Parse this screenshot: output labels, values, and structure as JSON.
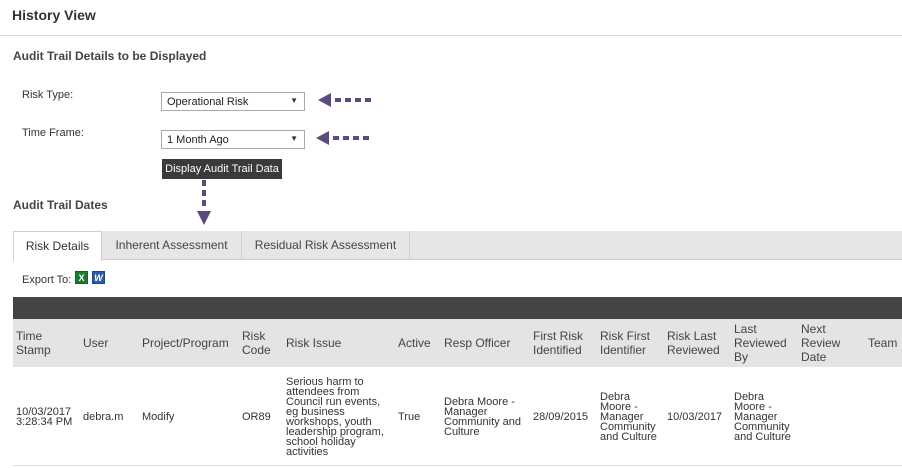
{
  "page": {
    "title": "History View"
  },
  "audit_details": {
    "section_title": "Audit Trail Details to be Displayed",
    "risk_type": {
      "label": "Risk Type:",
      "value": "Operational Risk"
    },
    "time_frame": {
      "label": "Time Frame:",
      "value": "1 Month Ago"
    },
    "display_button": "Display Audit Trail Data"
  },
  "audit_dates": {
    "section_title": "Audit Trail Dates"
  },
  "tabs": [
    {
      "label": "Risk Details",
      "active": true
    },
    {
      "label": "Inherent Assessment",
      "active": false
    },
    {
      "label": "Residual Risk Assessment",
      "active": false
    }
  ],
  "export": {
    "label": "Export To:",
    "excel_icon": "excel-icon",
    "word_icon": "word-icon"
  },
  "colors": {
    "arrow": "#5b4a7e",
    "table_topbar": "#444444",
    "header_bg": "#e4e4e4",
    "button_bg": "#3a3a3a"
  },
  "table": {
    "columns": [
      "Time Stamp",
      "User",
      "Project/Program",
      "Risk Code",
      "Risk Issue",
      "Active",
      "Resp Officer",
      "First Risk Identified",
      "Risk First Identifier",
      "Risk Last Reviewed",
      "Last Reviewed By",
      "Next Review Date",
      "Team"
    ],
    "rows": [
      {
        "time_stamp": "10/03/2017 3:28:34 PM",
        "user": "debra.m",
        "project": "Modify",
        "risk_code": "OR89",
        "risk_issue": "Serious harm to attendees from Council run events, eg business workshops, youth leadership program, school holiday activities",
        "active": "True",
        "resp_officer": "Debra Moore - Manager Community and Culture",
        "first_identified": "28/09/2015",
        "first_identifier": "Debra Moore - Manager Community and Culture",
        "last_reviewed": "10/03/2017",
        "last_reviewed_by": "Debra Moore - Manager Community and Culture",
        "next_review": "",
        "team": ""
      }
    ]
  }
}
